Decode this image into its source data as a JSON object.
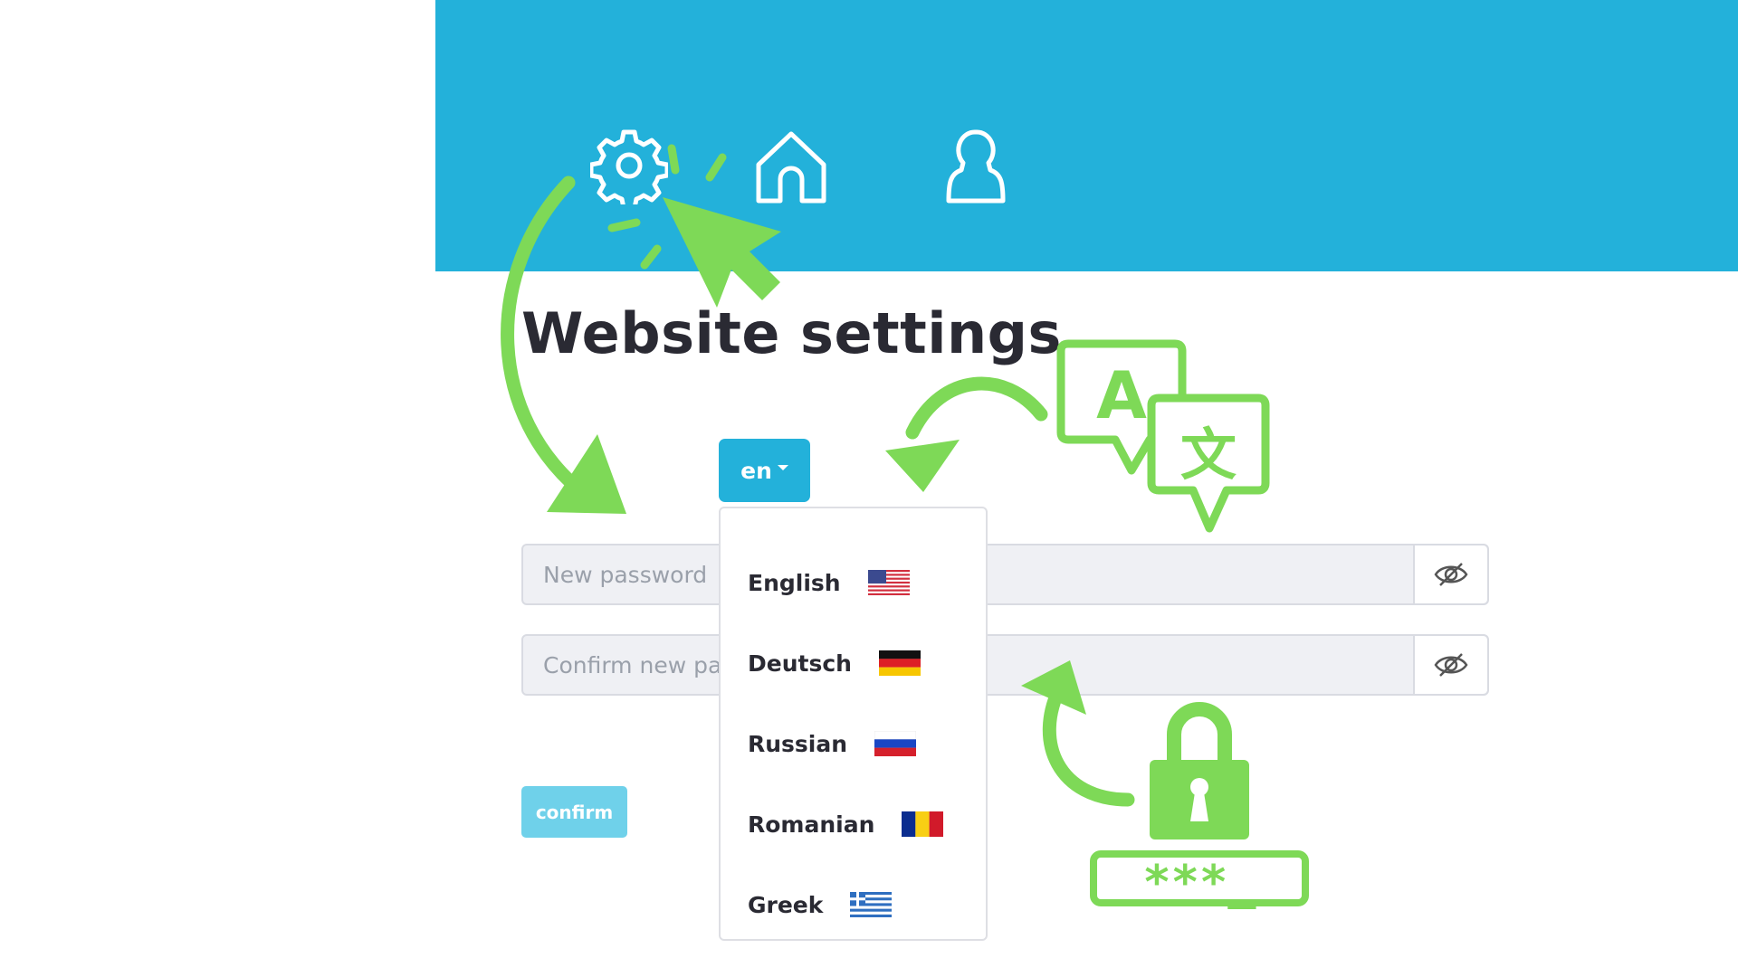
{
  "nav": {
    "icons": [
      "gear-icon",
      "home-icon",
      "user-icon"
    ]
  },
  "page": {
    "title": "Website settings"
  },
  "language": {
    "selected": "en",
    "options": [
      {
        "label": "English",
        "flag": "us-flag-icon"
      },
      {
        "label": "Deutsch",
        "flag": "germany-flag-icon"
      },
      {
        "label": "Russian",
        "flag": "russia-flag-icon"
      },
      {
        "label": "Romanian",
        "flag": "romania-flag-icon"
      },
      {
        "label": "Greek",
        "flag": "greece-flag-icon"
      }
    ]
  },
  "form": {
    "new_password_placeholder": "New password",
    "confirm_password_placeholder": "Confirm new password",
    "confirm_label": "confirm"
  },
  "colors": {
    "header": "#23b1da",
    "accent_green": "#7ed957",
    "confirm_button": "#6fd1ea",
    "text": "#2a2a33"
  },
  "annotations": {
    "translate_glyph_latin": "A",
    "translate_glyph_cjk": "文",
    "masked_password": "***_"
  }
}
